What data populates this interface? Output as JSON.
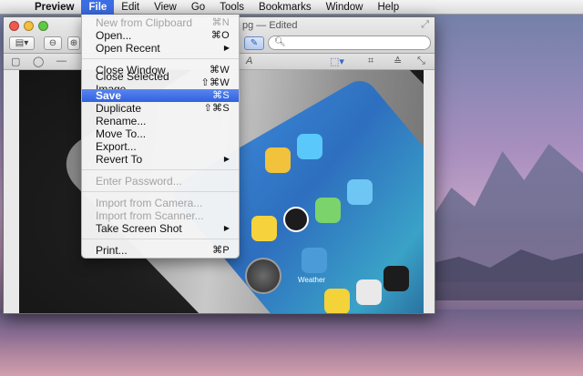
{
  "menubar": {
    "apple": "",
    "items": [
      "Preview",
      "File",
      "Edit",
      "View",
      "Go",
      "Tools",
      "Bookmarks",
      "Window",
      "Help"
    ]
  },
  "window": {
    "title": "pg — Edited",
    "search_placeholder": ""
  },
  "file_menu": {
    "new_from_clipboard": {
      "label": "New from Clipboard",
      "shortcut": "⌘N"
    },
    "open": {
      "label": "Open...",
      "shortcut": "⌘O"
    },
    "open_recent": {
      "label": "Open Recent",
      "submenu": "▶"
    },
    "close_window": {
      "label": "Close Window",
      "shortcut": "⌘W"
    },
    "close_selected_image": {
      "label": "Close Selected Image",
      "shortcut": "⇧⌘W"
    },
    "save": {
      "label": "Save",
      "shortcut": "⌘S"
    },
    "duplicate": {
      "label": "Duplicate",
      "shortcut": "⇧⌘S"
    },
    "rename": {
      "label": "Rename..."
    },
    "move_to": {
      "label": "Move To..."
    },
    "export": {
      "label": "Export..."
    },
    "revert_to": {
      "label": "Revert To",
      "submenu": "▶"
    },
    "enter_password": {
      "label": "Enter Password..."
    },
    "import_from_camera": {
      "label": "Import from Camera..."
    },
    "import_from_scanner": {
      "label": "Import from Scanner..."
    },
    "take_screen_shot": {
      "label": "Take Screen Shot",
      "submenu": "▶"
    },
    "print": {
      "label": "Print...",
      "shortcut": "⌘P"
    }
  },
  "phone_label": "Weather",
  "colors": {
    "menu_highlight": "#3d6ee6",
    "menu_disabled": "#a3a3a3"
  }
}
